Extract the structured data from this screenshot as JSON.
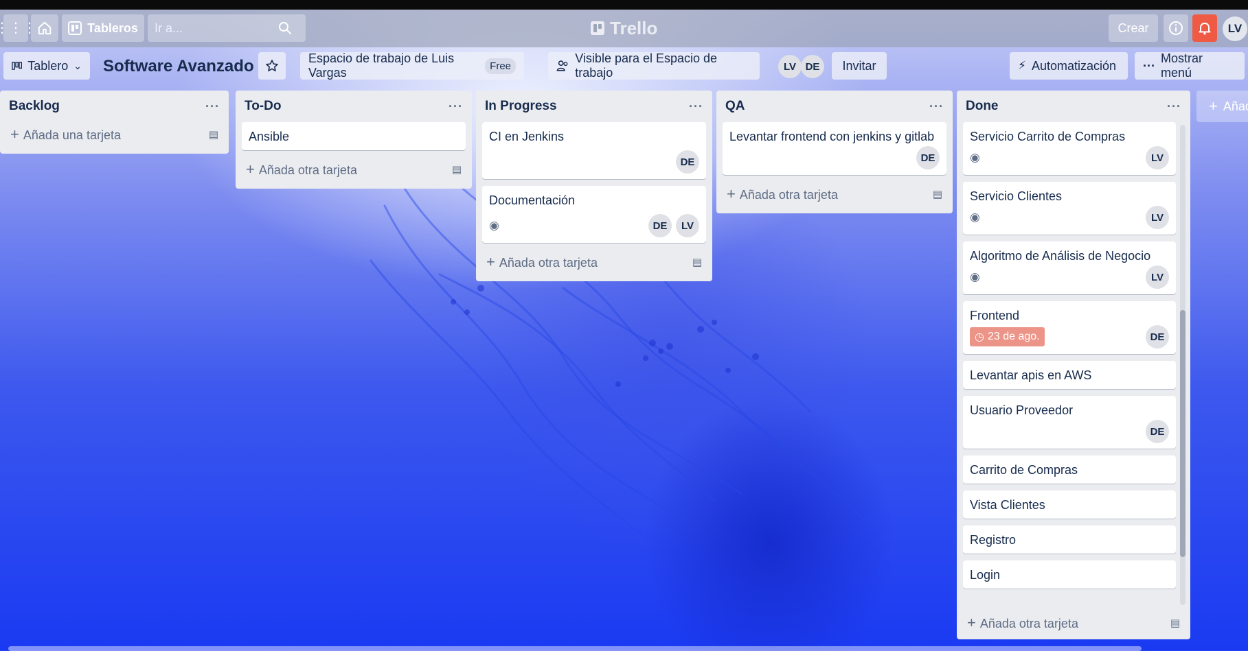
{
  "header": {
    "boards_label": "Tableros",
    "search_placeholder": "Ir a...",
    "logo_text": "Trello",
    "create_label": "Crear",
    "user_initials": "LV"
  },
  "board": {
    "view_label": "Tablero",
    "title": "Software Avanzado",
    "workspace_label": "Espacio de trabajo de Luis Vargas",
    "workspace_badge": "Free",
    "visibility_label": "Visible para el Espacio de trabajo",
    "members": [
      "LV",
      "DE"
    ],
    "invite_label": "Invitar",
    "automation_label": "Automatización",
    "menu_label": "Mostrar menú"
  },
  "lists": [
    {
      "title": "Backlog",
      "add_label": "Añada una tarjeta",
      "cards": []
    },
    {
      "title": "To-Do",
      "add_label": "Añada otra tarjeta",
      "cards": [
        {
          "title": "Ansible"
        }
      ]
    },
    {
      "title": "In Progress",
      "add_label": "Añada otra tarjeta",
      "cards": [
        {
          "title": "CI en Jenkins",
          "members": [
            "DE"
          ]
        },
        {
          "title": "Documentación",
          "watch": true,
          "members": [
            "DE",
            "LV"
          ]
        }
      ]
    },
    {
      "title": "QA",
      "add_label": "Añada otra tarjeta",
      "cards": [
        {
          "title": "Levantar frontend con jenkins y gitlab",
          "members": [
            "DE"
          ]
        }
      ]
    },
    {
      "title": "Done",
      "add_label": "Añada otra tarjeta",
      "cards": [
        {
          "title": "Servicio Carrito de Compras",
          "watch": true,
          "members": [
            "LV"
          ]
        },
        {
          "title": "Servicio Clientes",
          "watch": true,
          "members": [
            "LV"
          ]
        },
        {
          "title": "Algoritmo de Análisis de Negocio",
          "watch": true,
          "members": [
            "LV"
          ]
        },
        {
          "title": "Frontend",
          "due": "23 de ago.",
          "members": [
            "DE"
          ]
        },
        {
          "title": "Levantar apis en AWS"
        },
        {
          "title": "Usuario Proveedor",
          "members": [
            "DE"
          ]
        },
        {
          "title": "Carrito de Compras"
        },
        {
          "title": "Vista Clientes"
        },
        {
          "title": "Registro"
        },
        {
          "title": "Login"
        }
      ]
    }
  ],
  "add_list_label": "Añada otra lista",
  "colors": {
    "list_bg": "#ebecf0",
    "due_overdue": "#ec9488",
    "notification": "#ef5a44"
  }
}
